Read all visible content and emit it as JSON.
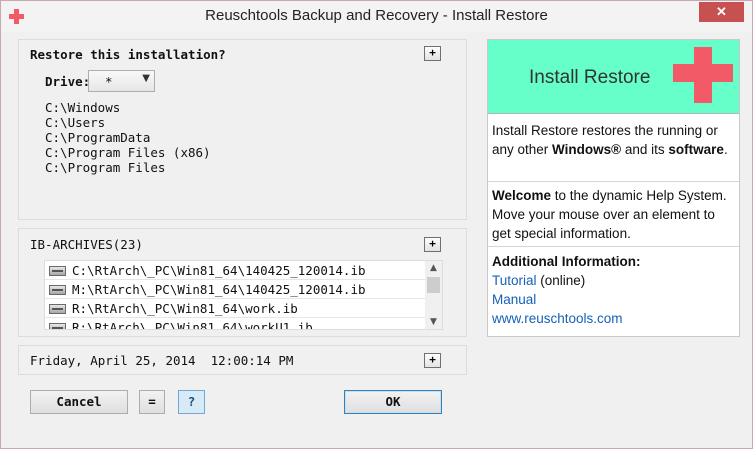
{
  "window": {
    "title": "Reuschtools Backup and Recovery - Install Restore",
    "close_label": "✕"
  },
  "restore_panel": {
    "heading": "Restore this installation?",
    "expand_label": "+",
    "drive_label": "Drive:",
    "drive_value": "*",
    "paths": [
      "C:\\Windows",
      "C:\\Users",
      "C:\\ProgramData",
      "C:\\Program Files (x86)",
      "C:\\Program Files"
    ]
  },
  "archives_panel": {
    "heading": "IB-ARCHIVES(23)",
    "expand_label": "+",
    "items": [
      "C:\\RtArch\\_PC\\Win81_64\\140425_120014.ib",
      "M:\\RtArch\\_PC\\Win81_64\\140425_120014.ib",
      "R:\\RtArch\\_PC\\Win81_64\\work.ib",
      "R:\\RtArch\\_PC\\Win81_64\\workU1.ib"
    ]
  },
  "datetime_panel": {
    "text": "Friday, April 25, 2014  12:00:14 PM",
    "expand_label": "+"
  },
  "buttons": {
    "cancel": "Cancel",
    "equals": "=",
    "help": "?",
    "ok": "OK"
  },
  "help": {
    "title": "Install Restore",
    "intro_1": "Install Restore restores the running or any other ",
    "intro_bold": "Windows®",
    "intro_2": " and its ",
    "intro_bold2": "software",
    "intro_end": ".",
    "welcome_bold": "Welcome",
    "welcome_rest": " to the dynamic Help System. Move your mouse over an element to get special information.",
    "additional_heading": "Additional Information:",
    "tutorial_link": "Tutorial",
    "tutorial_note": " (online)",
    "manual_link": "Manual",
    "website_link": "www.reuschtools.com"
  },
  "colors": {
    "accent_red": "#f25a67",
    "help_header_bg": "#66ffc9",
    "link_blue": "#1560b7"
  },
  "icons": {
    "app": "red-cross-icon",
    "disk": "hard-disk-icon",
    "close": "close-icon"
  }
}
